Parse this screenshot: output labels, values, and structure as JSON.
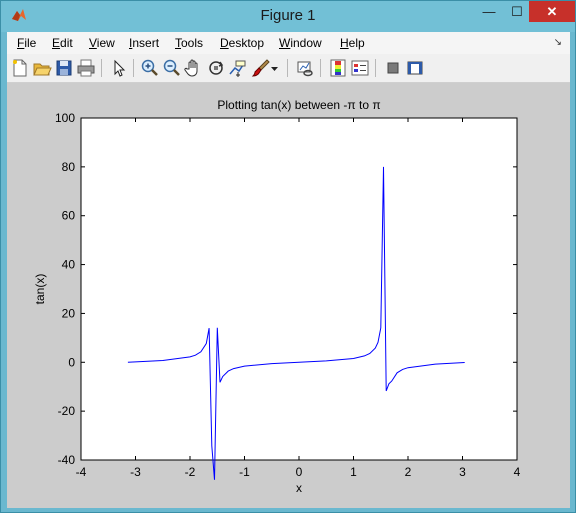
{
  "window": {
    "title": "Figure 1"
  },
  "controls": {
    "minimize": "—",
    "maximize": "☐",
    "close": "✕"
  },
  "menu": {
    "items": [
      {
        "accel": "F",
        "rest": "ile"
      },
      {
        "accel": "E",
        "rest": "dit"
      },
      {
        "accel": "V",
        "rest": "iew"
      },
      {
        "accel": "I",
        "rest": "nsert"
      },
      {
        "accel": "T",
        "rest": "ools"
      },
      {
        "accel": "D",
        "rest": "esktop"
      },
      {
        "accel": "W",
        "rest": "indow"
      },
      {
        "accel": "H",
        "rest": "elp"
      }
    ],
    "dock_arrow": "↘"
  },
  "toolbar": {
    "icons": [
      "new-figure-icon",
      "open-file-icon",
      "save-icon",
      "print-icon",
      "edit-plot-arrow-icon",
      "zoom-in-icon",
      "zoom-out-icon",
      "pan-hand-icon",
      "rotate-3d-icon",
      "data-cursor-icon",
      "brush-icon",
      "brush-dropdown-icon",
      "link-plot-icon",
      "colorbar-icon",
      "legend-icon",
      "hide-plot-tools-icon",
      "show-plot-tools-icon"
    ]
  },
  "chart_data": {
    "type": "line",
    "title": "Plotting tan(x) between -π to π",
    "xlabel": "x",
    "ylabel": "tan(x)",
    "xlim": [
      -4,
      4
    ],
    "ylim": [
      -40,
      100
    ],
    "xticks": [
      "-4",
      "-3",
      "-2",
      "-1",
      "0",
      "1",
      "2",
      "3",
      "4"
    ],
    "yticks": [
      "-40",
      "-20",
      "0",
      "20",
      "40",
      "60",
      "80",
      "100"
    ],
    "grid": false,
    "line_color": "#0000ff",
    "series": [
      {
        "x": [
          -3.14,
          -3.0,
          -2.5,
          -2.0,
          -1.9,
          -1.8,
          -1.7,
          -1.65,
          -1.6,
          -1.55,
          -1.5,
          -1.45,
          -1.4,
          -1.3,
          -1.2,
          -1.0,
          -0.5,
          0.0,
          0.5,
          1.0,
          1.2,
          1.3,
          1.4,
          1.45,
          1.5,
          1.55,
          1.6,
          1.65,
          1.7,
          1.8,
          1.9,
          2.0,
          2.5,
          3.0,
          3.04
        ],
        "y": [
          0.0,
          0.14,
          0.75,
          2.2,
          2.9,
          4.3,
          7.7,
          14.0,
          -34.2,
          -48.1,
          14.1,
          -8.2,
          -5.8,
          -3.6,
          -2.6,
          -1.56,
          -0.55,
          0.0,
          0.55,
          1.56,
          2.6,
          3.6,
          5.8,
          8.2,
          14.1,
          80.0,
          -11.7,
          -8.8,
          -7.7,
          -4.3,
          -2.9,
          -2.2,
          -0.75,
          -0.14,
          -0.1
        ]
      }
    ]
  }
}
